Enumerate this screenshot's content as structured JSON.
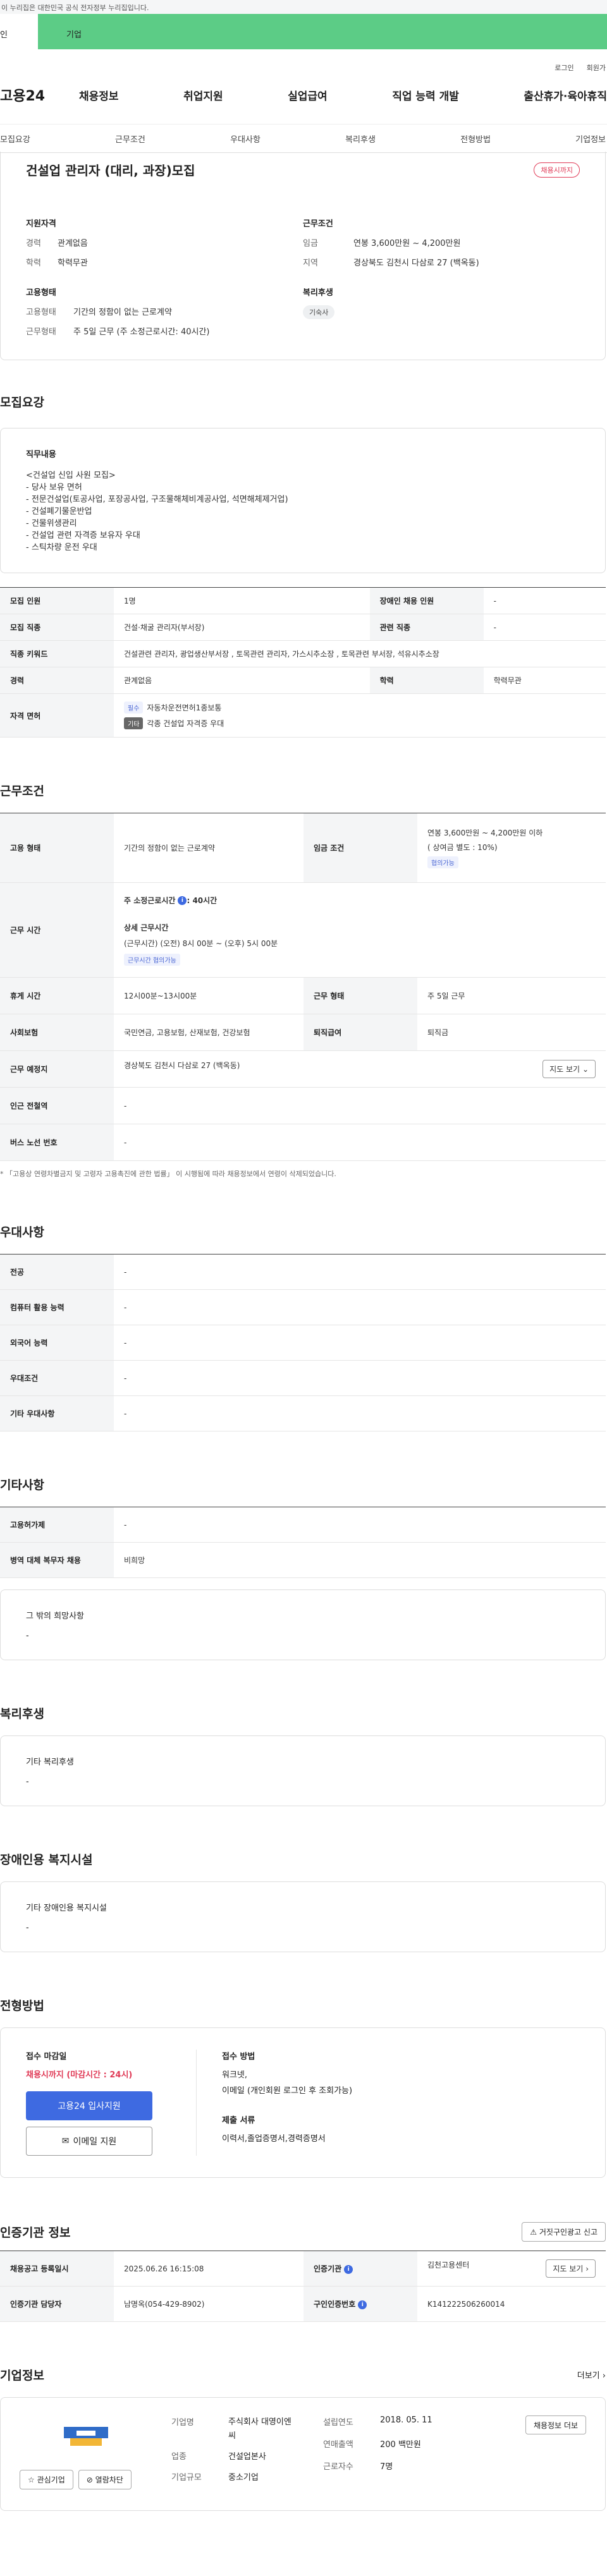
{
  "top_notice": "이 누리집은 대한민국 공식 전자정부 누리집입니다.",
  "tabs": [
    "인",
    "기업"
  ],
  "util": [
    "로그인",
    "회원가"
  ],
  "logo": "고용24",
  "gnb": [
    "채용정보",
    "취업지원",
    "실업급여",
    "직업 능력 개발",
    "출산휴가·육아휴직"
  ],
  "subnav": [
    "모집요강",
    "근무조건",
    "우대사항",
    "복리후생",
    "전형방법",
    "기업정보"
  ],
  "job": {
    "title": "건설업 관리자 (대리, 과장)모집",
    "badge": "채용시까지"
  },
  "summary": {
    "qual_h": "지원자격",
    "career_k": "경력",
    "career_v": "관계없음",
    "edu_k": "학력",
    "edu_v": "학력무관",
    "emp_h": "고용형태",
    "emptype_k": "고용형태",
    "emptype_v": "기간의 정함이 없는 근로계약",
    "work_k": "근무형태",
    "work_v": "주 5일 근무 (주 소정근로시간: 40시간)",
    "cond_h": "근무조건",
    "wage_k": "임금",
    "wage_v": "연봉 3,600만원 ~ 4,200만원",
    "region_k": "지역",
    "region_v": "경상북도 김천시 다삼로 27 (백옥동)",
    "welfare_h": "복리후생",
    "welfare_v": "기숙사"
  },
  "recruit": {
    "heading": "모집요강",
    "duty_h": "직무내용",
    "duty_text": "<건설업 신입 사원 모집>\n- 당사 보유 면허\n- 전문건설업(토공사업, 포장공사업, 구조물해체비계공사업, 석면해체제거업)\n- 건설폐기물운반업\n- 건물위생관리\n- 건설업 관련 자격증 보유자 우대\n- 스틱차량 운전 우대",
    "rows": {
      "count_k": "모집 인원",
      "count_v": "1명",
      "disabled_k": "장애인 채용 인원",
      "disabled_v": "-",
      "job_k": "모집 직종",
      "job_v": "건설·채굴 관리자(부서장)",
      "rel_k": "관련 직종",
      "rel_v": "-",
      "kw_k": "직종 키워드",
      "kw_v": "건설관련 관리자, 광업생산부서장 , 토목관련 관리자, 가스시추소장 , 토목관련 부서장, 석유시추소장",
      "career_k": "경력",
      "career_v": "관계없음",
      "edu_k": "학력",
      "edu_v": "학력무관",
      "lic_k": "자격 면허",
      "lic1_chip": "필수",
      "lic1": "자동차운전면허1종보통",
      "lic2_chip": "기타",
      "lic2": "각종 건설업 자격증 우대"
    }
  },
  "cond": {
    "heading": "근무조건",
    "emp_k": "고용 형태",
    "emp_v": "기간의 정함이 없는 근로계약",
    "wage_k": "임금 조건",
    "wage_v1": "연봉 3,600만원 ~ 4,200만원 이하",
    "wage_v2": "( 상여금 별도 : 10%)",
    "wage_chip": "협의가능",
    "hours_k": "근무 시간",
    "hours_total": "주 소정근로시간",
    "hours_total_v": ": 40시간",
    "hours_detail_h": "상세 근무시간",
    "hours_detail": "(근무시간) (오전) 8시 00분 ~ (오후) 5시 00분",
    "hours_chip": "근무시간 협의가능",
    "rest_k": "휴게 시간",
    "rest_v": "12시00분~13시00분",
    "type_k": "근무 형태",
    "type_v": "주 5일 근무",
    "ins_k": "사회보험",
    "ins_v": "국민연금, 고용보험, 산재보험, 건강보험",
    "ret_k": "퇴직급여",
    "ret_v": "퇴직금",
    "loc_k": "근무 예정지",
    "loc_v": "경상북도 김천시 다삼로 27 (백옥동)",
    "map_btn": "지도 보기",
    "station_k": "인근 전철역",
    "station_v": "-",
    "bus_k": "버스 노선 번호",
    "bus_v": "-",
    "note": "* 「고용상 연령차별금지 및 고령자 고용촉진에 관한 법률」 이 시행됨에 따라 채용정보에서 연령이 삭제되었습니다."
  },
  "pref": {
    "heading": "우대사항",
    "rows": [
      [
        "전공",
        "-"
      ],
      [
        "컴퓨터 활용 능력",
        "-"
      ],
      [
        "외국어 능력",
        "-"
      ],
      [
        "우대조건",
        "-"
      ],
      [
        "기타 우대사항",
        "-"
      ]
    ]
  },
  "etc": {
    "heading": "기타사항",
    "rows": [
      [
        "고용허가제",
        "-"
      ],
      [
        "병역 대체 복무자 채용",
        "비희망"
      ]
    ],
    "other_h": "그 밖의 희망사항",
    "other_v": "-"
  },
  "welfare": {
    "heading": "복리후생",
    "h": "기타 복리후생",
    "v": "-"
  },
  "disabled": {
    "heading": "장애인용 복지시설",
    "h": "기타 장애인용 복지시설",
    "v": "-"
  },
  "select": {
    "heading": "전형방법",
    "deadline_h": "접수 마감일",
    "deadline_v": "채용시까지 (마감시간 : 24시)",
    "apply_btn": "고용24 입사지원",
    "email_btn": "이메일 지원",
    "method_h": "접수 방법",
    "method_v1": "워크넷,",
    "method_v2": "이메일 (개인회원 로그인 후 조회가능)",
    "docs_h": "제출 서류",
    "docs_v": "이력서,졸업증명서,경력증명서"
  },
  "cert": {
    "heading": "인증기관 정보",
    "report_btn": "거짓구인광고 신고",
    "reg_k": "채용공고 등록일시",
    "reg_v": "2025.06.26 16:15:08",
    "agency_k": "인증기관",
    "agency_v": "김천고용센터",
    "map_btn": "지도 보기",
    "mgr_k": "인증기관 담당자",
    "mgr_v": "남명옥(054-429-8902)",
    "id_k": "구인인증번호",
    "id_v": "K141222506260014"
  },
  "company": {
    "heading": "기업정보",
    "more": "더보기",
    "fav_btn": "관심기업",
    "block_btn": "열람차단",
    "name_k": "기업명",
    "name_v": "주식회사 대영이엔씨",
    "industry_k": "업종",
    "industry_v": "건설업본사",
    "size_k": "기업규모",
    "size_v": "중소기업",
    "founded_k": "설립연도",
    "founded_v": "2018. 05. 11",
    "sales_k": "연매출액",
    "sales_v": "200 백만원",
    "emp_k": "근로자수",
    "emp_v": "7명",
    "jobs_btn": "채용정보 더보"
  }
}
